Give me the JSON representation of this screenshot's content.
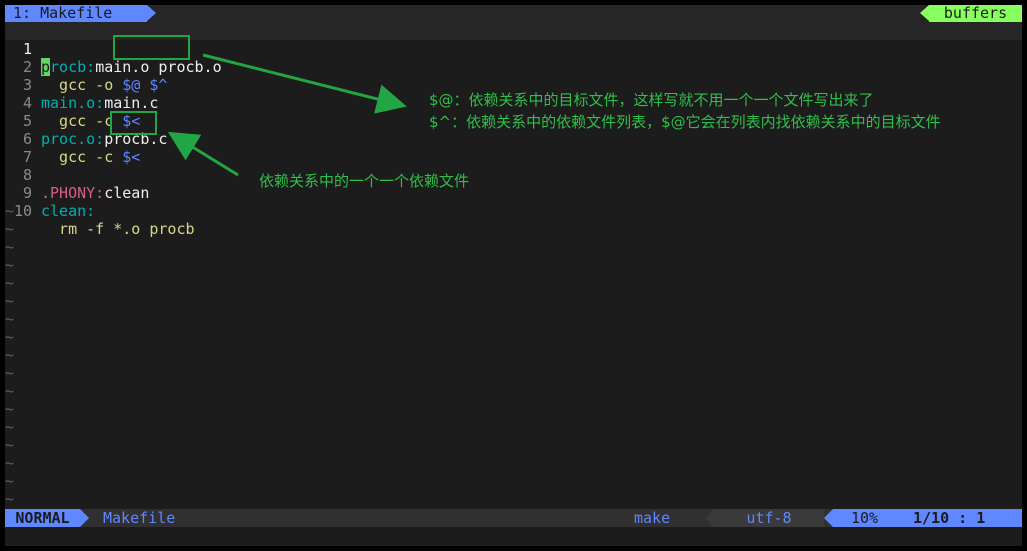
{
  "tabline": {
    "active_tab": "1: Makefile",
    "buffers_label": "buffers"
  },
  "editor": {
    "line_numbers": [
      "1",
      "2",
      "3",
      "4",
      "5",
      "6",
      "7",
      "8",
      "9",
      "10"
    ],
    "l1": {
      "cursor_char": "p",
      "target_rest": "rocb:",
      "deps": "main.o procb.o"
    },
    "l2": {
      "cmd": "  gcc -o ",
      "vars": "$@ $^"
    },
    "l3": {
      "target": "main.o:",
      "deps": "main.c"
    },
    "l4": {
      "cmd": "  gcc -c ",
      "vars": "$<"
    },
    "l5": {
      "target": "proc.o:",
      "deps": "procb.c"
    },
    "l6": {
      "cmd": "  gcc -c ",
      "vars": "$<"
    },
    "l8": {
      "target": ".PHONY:",
      "deps": "clean"
    },
    "l9": {
      "target": "clean:"
    },
    "l10": {
      "cmd": "  rm -f *.o procb"
    },
    "tilde": "~"
  },
  "annotations": {
    "note1_line1": "$@：依赖关系中的目标文件，这样写就不用一个一个文件写出来了",
    "note1_line2": "$^：依赖关系中的依赖文件列表，$@它会在列表内找依赖关系中的目标文件",
    "note2": "依赖关系中的一个一个依赖文件",
    "color": "#22a545"
  },
  "statusline": {
    "mode": "NORMAL",
    "filename": "Makefile",
    "filetype": "make",
    "encoding": "utf-8",
    "percent": "10%",
    "line_col": "1/10 :  1"
  },
  "colors": {
    "accent": "#5f87ff",
    "buffers": "#87ff5f",
    "cursor": "#5fd75f"
  }
}
